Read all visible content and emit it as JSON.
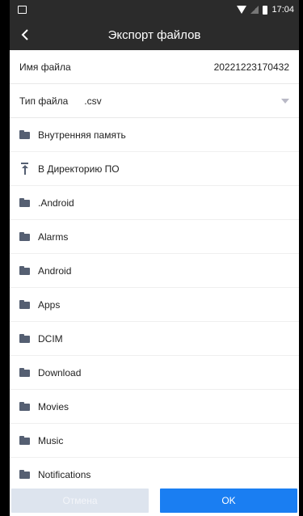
{
  "status_bar": {
    "time": "17:04",
    "icons": [
      "image-icon",
      "wifi-icon",
      "signal-icon",
      "battery-icon"
    ]
  },
  "app_bar": {
    "title": "Экспорт файлов",
    "back_icon": "chevron-left-icon"
  },
  "form": {
    "file_name_label": "Имя файла",
    "file_name_value": "20221223170432",
    "file_type_label": "Тип файла",
    "file_type_value": ".csv"
  },
  "locations": [
    {
      "label": "Внутренняя память",
      "icon": "folder-open-icon"
    },
    {
      "label": "В Директорию ПО",
      "icon": "upload-icon"
    }
  ],
  "folders": [
    {
      "label": ".Android"
    },
    {
      "label": "Alarms"
    },
    {
      "label": "Android"
    },
    {
      "label": "Apps"
    },
    {
      "label": "DCIM"
    },
    {
      "label": "Download"
    },
    {
      "label": "Movies"
    },
    {
      "label": "Music"
    },
    {
      "label": "Notifications"
    }
  ],
  "buttons": {
    "cancel": "Отмена",
    "ok": "OK"
  },
  "colors": {
    "header_bg": "#2b2b2b",
    "icon": "#555f72",
    "ok_button": "#1a7ef2",
    "cancel_button": "#dde4ee"
  }
}
